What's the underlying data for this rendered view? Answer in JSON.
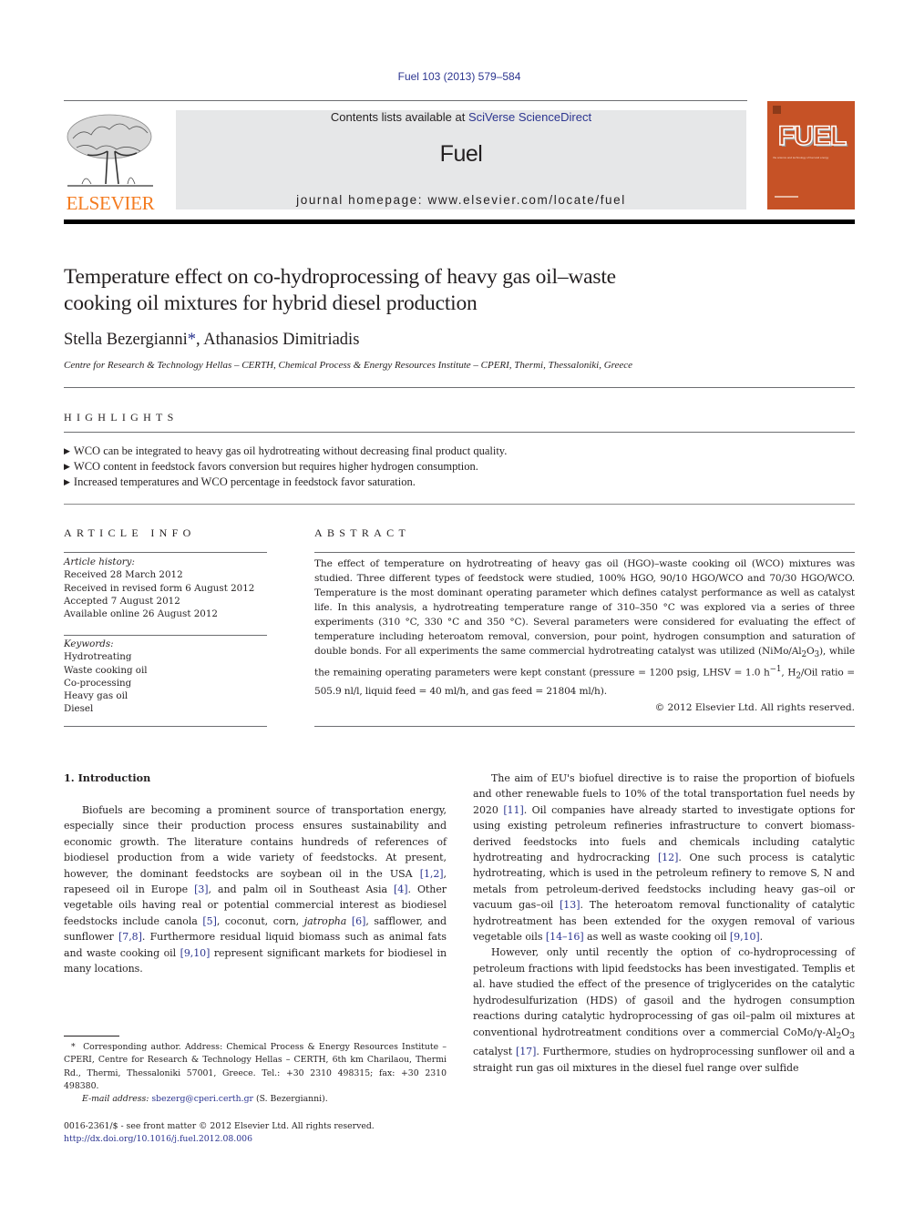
{
  "header": {
    "citation": "Fuel 103 (2013) 579–584",
    "contents_prefix": "Contents lists available at ",
    "contents_link": "SciVerse ScienceDirect",
    "journal_name": "Fuel",
    "homepage": "journal homepage: www.elsevier.com/locate/fuel",
    "publisher_logo_text": "ELSEVIER",
    "cover_title": "FUEL",
    "cover_subtitle": "the science and technology of fuel and energy",
    "colors": {
      "publisher_orange": "#f47b20",
      "cover_orange": "#c65226",
      "link_blue": "#2c3590",
      "masthead_gray": "#e6e7e8"
    }
  },
  "article": {
    "title_line1": "Temperature effect on co-hydroprocessing of heavy gas oil–waste",
    "title_line2": "cooking oil mixtures for hybrid diesel production",
    "authors": [
      {
        "name": "Stella Bezergianni",
        "mark": "*"
      },
      {
        "name": "Athanasios Dimitriadis",
        "mark": ""
      }
    ],
    "author_separator": ", ",
    "affiliation": "Centre for Research & Technology Hellas – CERTH, Chemical Process & Energy Resources Institute – CPERI, Thermi, Thessaloniki, Greece"
  },
  "highlights": {
    "heading": "HIGHLIGHTS",
    "bullet_icon": "triangle-right-icon",
    "items": [
      "WCO can be integrated to heavy gas oil hydrotreating without decreasing final product quality.",
      "WCO content in feedstock favors conversion but requires higher hydrogen consumption.",
      "Increased temperatures and WCO percentage in feedstock favor saturation."
    ]
  },
  "article_info": {
    "heading": "ARTICLE INFO",
    "history_label": "Article history:",
    "history": [
      "Received 28 March 2012",
      "Received in revised form 6 August 2012",
      "Accepted 7 August 2012",
      "Available online 26 August 2012"
    ],
    "keywords_label": "Keywords:",
    "keywords": [
      "Hydrotreating",
      "Waste cooking oil",
      "Co-processing",
      "Heavy gas oil",
      "Diesel"
    ]
  },
  "abstract": {
    "heading": "ABSTRACT",
    "part1": "The effect of temperature on hydrotreating of heavy gas oil (HGO)–waste cooking oil (WCO) mixtures was studied. Three different types of feedstock were studied, 100% HGO, 90/10 HGO/WCO and 70/30 HGO/WCO. Temperature is the most dominant operating parameter which defines catalyst performance as well as catalyst life. In this analysis, a hydrotreating temperature range of 310–350 °C was explored via a series of three experiments (310 °C, 330 °C and 350 °C). Several parameters were considered for evaluating the effect of temperature including heteroatom removal, conversion, pour point, hydrogen consumption and saturation of double bonds. For all experiments the same commercial hydrotreating catalyst was utilized (NiMo/Al",
    "sub2": "2",
    "part2": "O",
    "sub3": "3",
    "part3": "), while the remaining operating parameters were kept constant (pressure = 1200 psig, LHSV = 1.0 h",
    "sup_neg1": "−1",
    "part4": ", H",
    "sub_h2": "2",
    "part5": "/Oil ratio = 505.9 nl/l, liquid feed = 40 ml/h, and gas feed = 21804 ml/h).",
    "copyright": "© 2012 Elsevier Ltd. All rights reserved."
  },
  "introduction": {
    "heading": "1. Introduction",
    "left_p1": [
      {
        "t": "Biofuels are becoming a prominent source of transportation energy, especially since their production process ensures sustainability and economic growth. The literature contains hundreds of references of biodiesel production from a wide variety of feedstocks. At present, however, the dominant feedstocks are soybean oil in the USA "
      },
      {
        "ref": "[1,2]"
      },
      {
        "t": ", rapeseed oil in Europe "
      },
      {
        "ref": "[3]"
      },
      {
        "t": ", and palm oil in Southeast Asia "
      },
      {
        "ref": "[4]"
      },
      {
        "t": ". Other vegetable oils having real or potential commercial interest as biodiesel feedstocks include canola "
      },
      {
        "ref": "[5]"
      },
      {
        "t": ", coconut, corn, "
      },
      {
        "i": "jatropha"
      },
      {
        "t": " "
      },
      {
        "ref": "[6]"
      },
      {
        "t": ", safflower, and sunflower "
      },
      {
        "ref": "[7,8]"
      },
      {
        "t": ". Furthermore residual liquid biomass such as animal fats and waste cooking oil "
      },
      {
        "ref": "[9,10]"
      },
      {
        "t": " represent significant markets for biodiesel in many locations."
      }
    ],
    "right_p1": [
      {
        "t": "The aim of EU's biofuel directive is to raise the proportion of biofuels and other renewable fuels to 10% of the total transportation fuel needs by 2020 "
      },
      {
        "ref": "[11]"
      },
      {
        "t": ". Oil companies have already started to investigate options for using existing petroleum refineries infrastructure to convert biomass-derived feedstocks into fuels and chemicals including catalytic hydrotreating and hydrocracking "
      },
      {
        "ref": "[12]"
      },
      {
        "t": ". One such process is catalytic hydrotreating, which is used in the petroleum refinery to remove S, N and metals from petroleum-derived feedstocks including heavy gas–oil or vacuum gas–oil "
      },
      {
        "ref": "[13]"
      },
      {
        "t": ". The heteroatom removal functionality of catalytic hydrotreatment has been extended for the oxygen removal of various vegetable oils "
      },
      {
        "ref": "[14–16]"
      },
      {
        "t": " as well as waste cooking oil "
      },
      {
        "ref": "[9,10]"
      },
      {
        "t": "."
      }
    ],
    "right_p2": [
      {
        "t": "However, only until recently the option of co-hydroprocessing of petroleum fractions with lipid feedstocks has been investigated. Templis et al. have studied the effect of the presence of triglycerides on the catalytic hydrodesulfurization (HDS) of gasoil and the hydrogen consumption reactions during catalytic hydroprocessing of gas oil–palm oil mixtures at conventional hydrotreatment conditions over a commercial CoMo/γ-Al"
      },
      {
        "sub": "2"
      },
      {
        "t": "O"
      },
      {
        "sub": "3"
      },
      {
        "t": " catalyst "
      },
      {
        "ref": "[17]"
      },
      {
        "t": ". Furthermore, studies on hydroprocessing sunflower oil and a straight run gas oil mixtures in the diesel fuel range over sulfide"
      }
    ]
  },
  "footnote": {
    "mark": "*",
    "text": "Corresponding author. Address: Chemical Process & Energy Resources Institute – CPERI, Centre for Research & Technology Hellas – CERTH, 6th km Charilaou, Thermi Rd., Thermi, Thessaloniki 57001, Greece. Tel.: +30 2310 498315; fax: +30 2310 498380.",
    "email_label": "E-mail address:",
    "email": "sbezerg@cperi.certh.gr",
    "email_suffix": " (S. Bezergianni)."
  },
  "front_matter": {
    "issn_line": "0016-2361/$ - see front matter © 2012 Elsevier Ltd. All rights reserved.",
    "doi": "http://dx.doi.org/10.1016/j.fuel.2012.08.006"
  }
}
